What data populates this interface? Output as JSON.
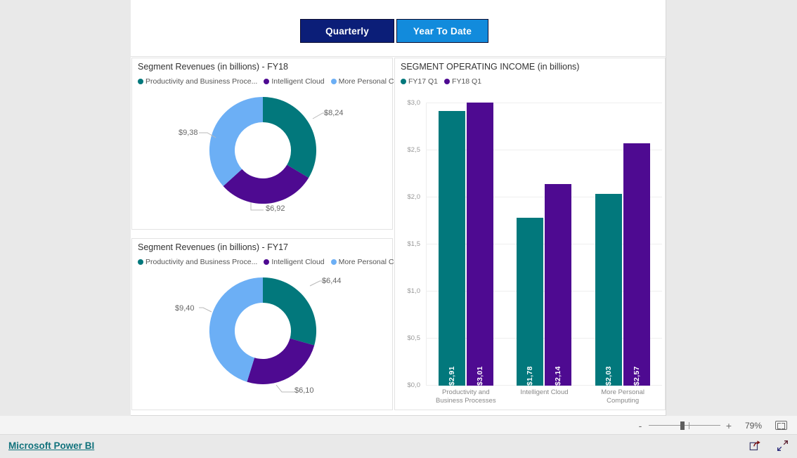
{
  "toolbar": {
    "quarterly_label": "Quarterly",
    "ytd_label": "Year To Date"
  },
  "colors": {
    "teal": "#02787C",
    "purple": "#4E0A91",
    "light_blue": "#6CAFF5",
    "quarterly_bg": "#0B1E78",
    "ytd_bg": "#128BDC",
    "link": "#11727C"
  },
  "donut_fy18": {
    "title": "Segment Revenues (in billions) - FY18",
    "legend": [
      "Productivity and Business Proce...",
      "Intelligent Cloud",
      "More Personal Computing"
    ],
    "labels": {
      "teal": "$8,24",
      "purple": "$6,92",
      "blue": "$9,38"
    }
  },
  "donut_fy17": {
    "title": "Segment Revenues (in billions) - FY17",
    "legend": [
      "Productivity and Business Proce...",
      "Intelligent Cloud",
      "More Personal Computing"
    ],
    "labels": {
      "teal": "$6,44",
      "purple": "$6,10",
      "blue": "$9,40"
    }
  },
  "bar_chart": {
    "title": "SEGMENT OPERATING INCOME (in billions)",
    "legend": [
      "FY17 Q1",
      "FY18 Q1"
    ]
  },
  "status_bar": {
    "minus": "-",
    "plus": "+",
    "zoom_level": "79%",
    "fit_icon": "fit-to-page-icon"
  },
  "footer": {
    "brand": "Microsoft Power BI",
    "share_icon": "share-icon",
    "fullscreen_icon": "fullscreen-icon"
  },
  "chart_data": [
    {
      "type": "pie",
      "title": "Segment Revenues (in billions) - FY18",
      "subtitle": "",
      "labels": [
        "Productivity and Business Processes",
        "Intelligent Cloud",
        "More Personal Computing"
      ],
      "values": [
        8.24,
        6.92,
        9.38
      ],
      "value_labels": [
        "$8,24",
        "$6,92",
        "$9,38"
      ],
      "colors": [
        "#02787C",
        "#4E0A91",
        "#6CAFF5"
      ],
      "legend_position": "top",
      "donut": true
    },
    {
      "type": "pie",
      "title": "Segment Revenues (in billions) - FY17",
      "subtitle": "",
      "labels": [
        "Productivity and Business Processes",
        "Intelligent Cloud",
        "More Personal Computing"
      ],
      "values": [
        6.44,
        6.1,
        9.4
      ],
      "value_labels": [
        "$6,44",
        "$6,10",
        "$9,40"
      ],
      "colors": [
        "#02787C",
        "#4E0A91",
        "#6CAFF5"
      ],
      "legend_position": "top",
      "donut": true
    },
    {
      "type": "bar",
      "title": "SEGMENT OPERATING INCOME (in billions)",
      "xlabel": "",
      "ylabel": "",
      "categories": [
        "Productivity and Business Processes",
        "Intelligent Cloud",
        "More Personal Computing"
      ],
      "category_labels": [
        [
          "Productivity and",
          "Business Processes"
        ],
        [
          "Intelligent Cloud",
          ""
        ],
        [
          "More Personal",
          "Computing"
        ]
      ],
      "series": [
        {
          "name": "FY17 Q1",
          "color": "#02787C",
          "values": [
            2.91,
            1.78,
            2.03
          ],
          "value_labels": [
            "$2,91",
            "$1,78",
            "$2,03"
          ]
        },
        {
          "name": "FY18 Q1",
          "color": "#4E0A91",
          "values": [
            3.01,
            2.14,
            2.57
          ],
          "value_labels": [
            "$3,01",
            "$2,14",
            "$2,57"
          ]
        }
      ],
      "ylim": [
        0,
        3.0
      ],
      "yticks": [
        "$0,0",
        "$0,5",
        "$1,0",
        "$1,5",
        "$2,0",
        "$2,5",
        "$3,0"
      ],
      "ytick_values": [
        0,
        0.5,
        1.0,
        1.5,
        2.0,
        2.5,
        3.0
      ],
      "grid": true,
      "legend_position": "top"
    }
  ]
}
